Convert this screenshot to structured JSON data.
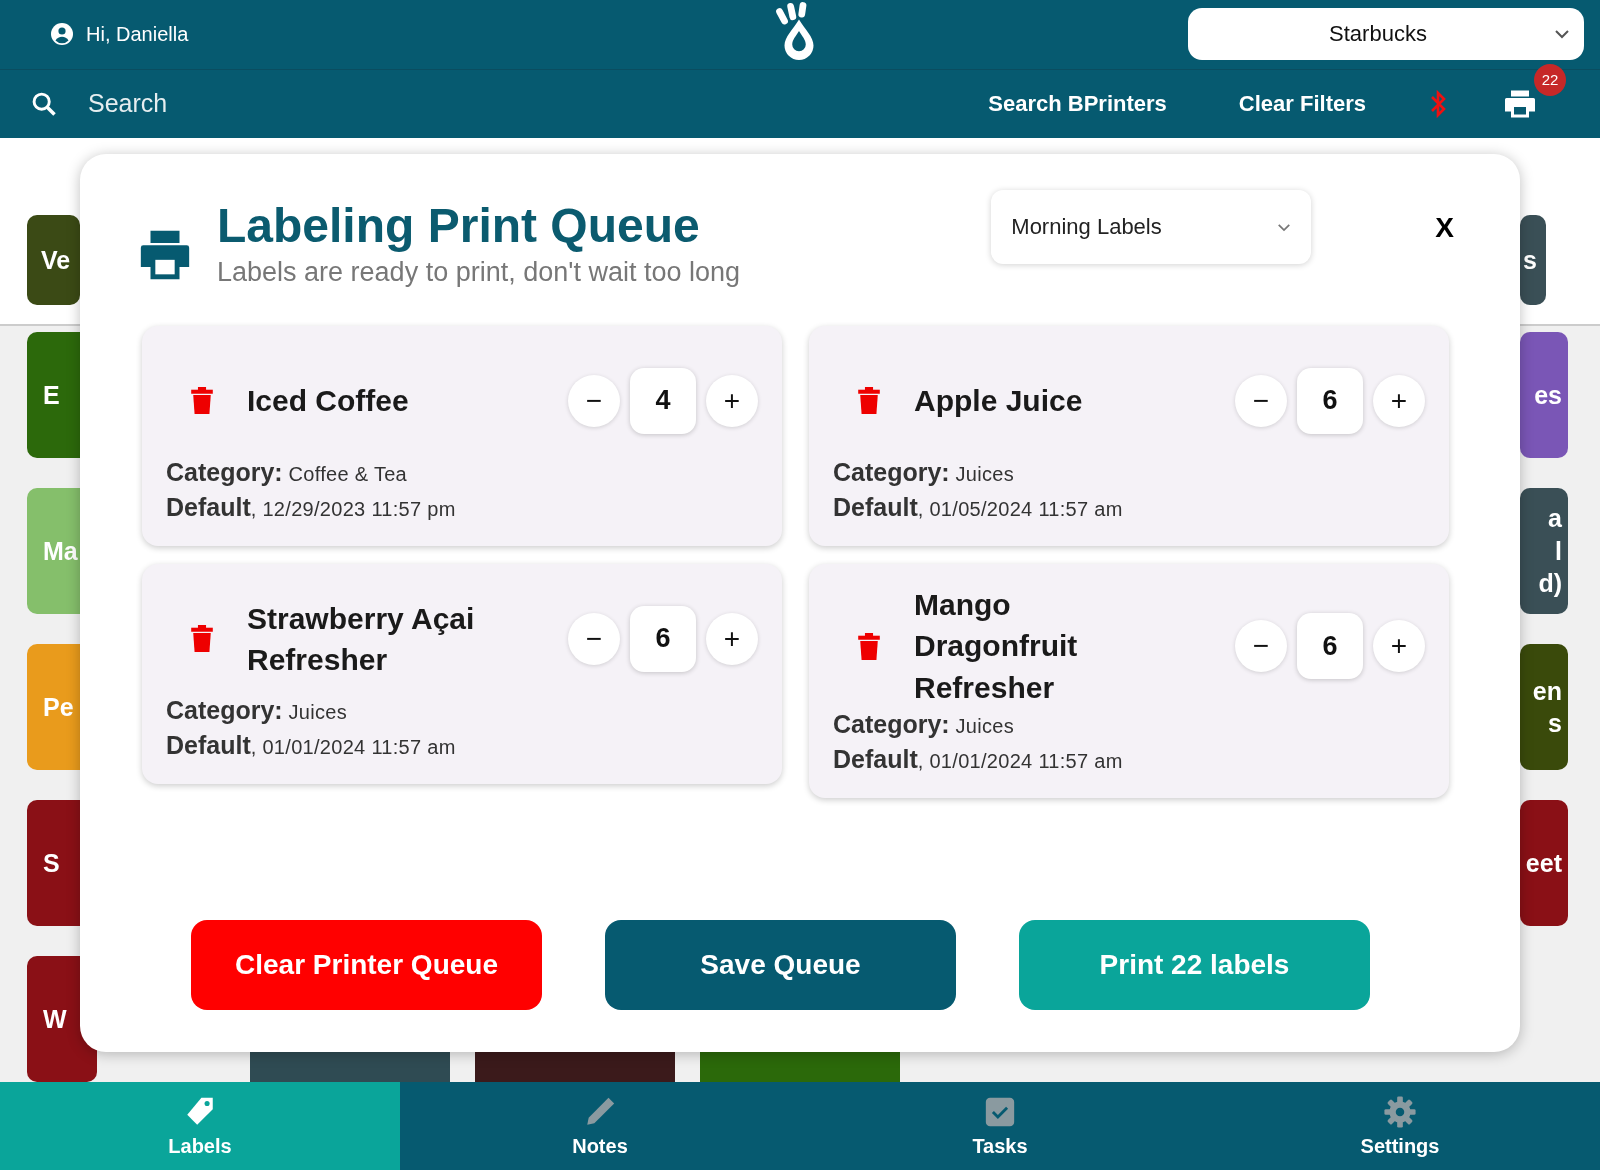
{
  "header": {
    "greeting": "Hi, Daniella",
    "store_select": {
      "value": "Starbucks"
    }
  },
  "search_bar": {
    "placeholder": "Search",
    "actions": [
      "Search BPrinters",
      "Clear Filters"
    ],
    "printer_badge": "22"
  },
  "background_tiles": {
    "left": [
      {
        "lines": [
          "Ve"
        ],
        "color": "#3b4a15"
      },
      {
        "lines": [
          "E"
        ],
        "color": "#2c690b"
      },
      {
        "lines": [
          "Ma"
        ],
        "color": "#85bf6b"
      },
      {
        "lines": [
          "Pe"
        ],
        "color": "#e99b1c"
      },
      {
        "lines": [
          "S"
        ],
        "color": "#8a1016"
      },
      {
        "lines": [
          "W"
        ],
        "color": "#8a1016"
      }
    ],
    "right": [
      {
        "lines": [
          "s"
        ],
        "color": "#3a4f56"
      },
      {
        "lines": [
          "es"
        ],
        "color": "#7a56b6"
      },
      {
        "lines": [
          "a",
          "l",
          "d)"
        ],
        "color": "#3a4f56"
      },
      {
        "lines": [
          "en",
          "s"
        ],
        "color": "#3a4a0b"
      },
      {
        "lines": [
          "eet"
        ],
        "color": "#8a1016"
      }
    ],
    "bottom": [
      {
        "color": "#2f4b53"
      },
      {
        "color": "#3b1a1b"
      },
      {
        "color": "#2b690a"
      }
    ]
  },
  "modal": {
    "title": "Labeling Print Queue",
    "subtitle": "Labels are ready to print, don't wait too long",
    "queue_select": {
      "value": "Morning Labels"
    },
    "close": "X",
    "items": [
      {
        "name": "Iced Coffee",
        "minus": "−",
        "quantity": "4",
        "plus": "+",
        "category": "**Category:** Coffee & Tea",
        "default": "**Default**, 12/29/2023 11:57 pm"
      },
      {
        "name": "Apple Juice",
        "minus": "−",
        "quantity": "6",
        "plus": "+",
        "category": "**Category:** Juices",
        "default": "**Default**, 01/05/2024 11:57 am"
      },
      {
        "name": "Strawberry Açai Refresher",
        "minus": "−",
        "quantity": "6",
        "plus": "+",
        "category": "**Category:** Juices",
        "default": "**Default**, 01/01/2024 11:57 am"
      },
      {
        "name": "Mango Dragonfruit Refresher",
        "minus": "−",
        "quantity": "6",
        "plus": "+",
        "category": "**Category:** Juices",
        "default": "**Default**, 01/01/2024 11:57 am"
      }
    ],
    "buttons": [
      {
        "label": "Clear Printer Queue",
        "kind": "danger"
      },
      {
        "label": "Save Queue",
        "kind": "primary"
      },
      {
        "label": "Print 22 labels",
        "kind": "accent"
      }
    ]
  },
  "bottom_nav": [
    {
      "label": "Labels",
      "kind": "tag",
      "selected": true
    },
    {
      "label": "Notes",
      "kind": "pencil",
      "selected": false
    },
    {
      "label": "Tasks",
      "kind": "checkbox",
      "selected": false
    },
    {
      "label": "Settings",
      "kind": "gear",
      "selected": false
    }
  ]
}
